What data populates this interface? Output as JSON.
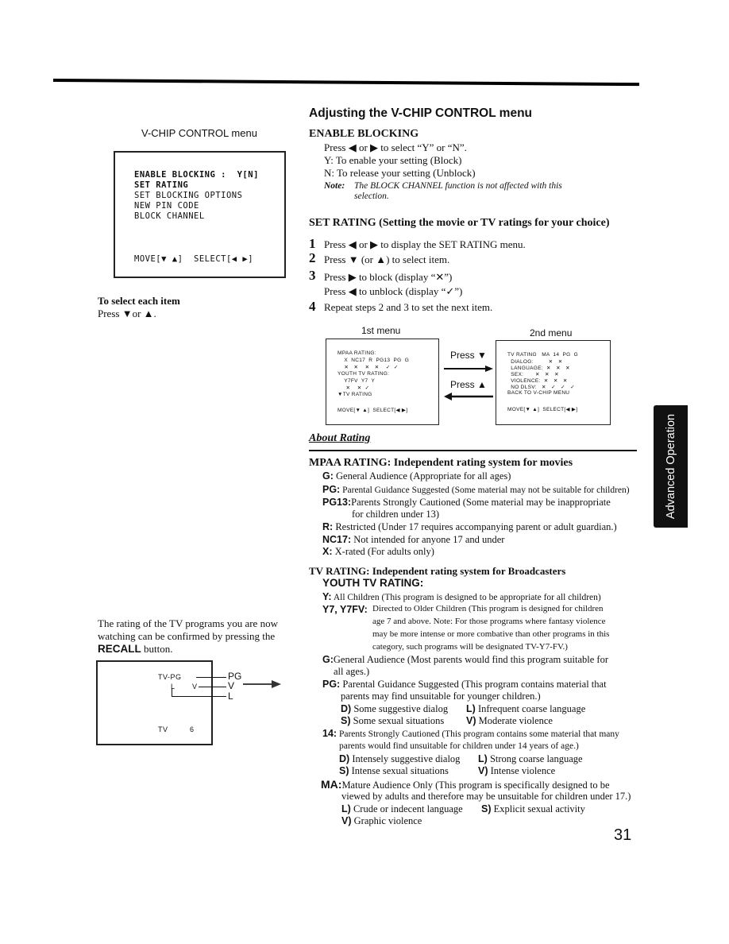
{
  "left": {
    "vchip_caption": "V-CHIP CONTROL menu",
    "vchip_menu": {
      "lines": [
        "ENABLE BLOCKING :  Y[N]",
        "SET RATING",
        "SET BLOCKING OPTIONS",
        "NEW PIN CODE",
        "BLOCK CHANNEL"
      ],
      "footer": "MOVE[▼ ▲]  SELECT[◀ ▶]"
    },
    "select_title": "To select each item",
    "select_body": "Press ▼or ▲.",
    "recall_text_pre": "The rating of the TV programs you are now watching can be confirmed by pressing the ",
    "recall_button": "RECALL",
    "recall_text_post": " button.",
    "tv_screen": {
      "rating_code": "TV-PG",
      "sub_l": "L",
      "sub_v": "V",
      "label_pg": "PG",
      "label_v": "V",
      "label_l": "L",
      "channel_label": "TV",
      "channel_number": "6"
    }
  },
  "right": {
    "title": "Adjusting the V-CHIP CONTROL menu",
    "enable_blocking": {
      "heading": "ENABLE BLOCKING",
      "lines": [
        "Press ◀ or ▶  to select “Y” or “N”.",
        "Y: To enable your setting (Block)",
        "N: To release your setting (Unblock)"
      ],
      "note_label": "Note:",
      "note_text": "The BLOCK CHANNEL function is not affected with this",
      "note_text2": "selection."
    },
    "set_rating": {
      "heading": "SET RATING (Setting the movie or TV ratings for your choice)",
      "steps": [
        {
          "num": "1",
          "text": "Press ◀ or ▶  to display the SET RATING menu."
        },
        {
          "num": "2",
          "text": "Press ▼  (or ▲) to select item."
        },
        {
          "num": "3",
          "text": "Press ▶ to block (display “✕”)",
          "text2": "Press ◀ to unblock (display “✓”)"
        },
        {
          "num": "4",
          "text": "Repeat steps 2 and 3 to set the next item."
        }
      ]
    },
    "menus": {
      "first_caption": "1st menu",
      "second_caption": "2nd menu",
      "press_down": "Press ▼",
      "press_up": "Press ▲",
      "first_lines": [
        "MPAA RATING:",
        "    X  NC17  R  PG13  PG  G",
        "    ✕   ✕    ✕   ✕    ✓  ✓",
        "YOUTH TV RATING:",
        "    Y7FV  Y7  Y",
        "     ✕    ✕  ✓",
        "▼TV RATING",
        "MOVE[▼ ▲]  SELECT[◀ ▶]"
      ],
      "second_lines": [
        "TV RATING   MA  14  PG  G",
        "  DIALOG:         ✕   ✕",
        "  LANGUAGE:  ✕   ✕   ✕",
        "  SEX:       ✕   ✕   ✕",
        "  VIOLENCE:  ✕   ✕   ✕",
        "  NO DLSV:   ✕   ✓   ✓   ✓",
        "BACK TO V-CHIP MENU",
        "MOVE[▼ ▲]  SELECT[◀ ▶]"
      ]
    },
    "about_rating": {
      "title": "About Rating",
      "mpaa_heading": "MPAA RATING: Independent rating system for movies",
      "mpaa": [
        {
          "key": "G:",
          "text": " General Audience (Appropriate for all ages)"
        },
        {
          "key": "PG:",
          "text": "  Parental Guidance Suggested (Some material may not be suitable for children)"
        },
        {
          "key": "PG13:",
          "text": "Parents Strongly Cautioned (Some material may be inappropriate",
          "text2": "for children under 13)"
        },
        {
          "key": "R:",
          "text": " Restricted (Under 17 requires accompanying parent or adult guardian.)"
        },
        {
          "key": "NC17:",
          "text": " Not intended for anyone 17 and under"
        },
        {
          "key": "X:",
          "text": "  X-rated (For adults only)"
        }
      ],
      "tv_heading": "TV RATING: Independent rating system for Broadcasters",
      "youth_heading": "YOUTH TV RATING:",
      "youth": [
        {
          "key": "Y:",
          "text": " All Children (This program is designed to be appropriate for all children)"
        },
        {
          "key": "Y7, Y7FV:",
          "lines": [
            "Directed to Older Children (This program is designed for children",
            "age 7 and above. Note: For those programs where fantasy violence",
            "may be more intense or more combative than other programs in this",
            "category, such programs will be designated TV-Y7-FV.)"
          ]
        }
      ],
      "tv": [
        {
          "key": "G:",
          "text": "General Audience (Most parents would find this program suitable for",
          "text2": "all ages.)"
        },
        {
          "key": "PG:",
          "text": " Parental Guidance Suggested (This program contains material that",
          "text2": "parents may find unsuitable for younger children.)",
          "subs": [
            [
              "D)",
              " Some suggestive dialog",
              "L)",
              " Infrequent coarse language"
            ],
            [
              "S)",
              " Some sexual situations",
              "V)",
              " Moderate violence"
            ]
          ]
        },
        {
          "key": "14:",
          "text": " Parents Strongly Cautioned (This program contains some material that many",
          "text2": "parents would find unsuitable for children under 14 years of age.)",
          "subs": [
            [
              "D)",
              " Intensely suggestive dialog",
              "L)",
              " Strong coarse language"
            ],
            [
              "S)",
              " Intense sexual situations",
              "V)",
              " Intense violence"
            ]
          ]
        },
        {
          "key": "MA:",
          "text": "Mature Audience Only (This program is specifically designed to be",
          "text2": "viewed by adults and therefore may be unsuitable for children under 17.)",
          "subs": [
            [
              "L)",
              " Crude or indecent language",
              "S)",
              " Explicit sexual activity"
            ],
            [
              "V)",
              " Graphic violence",
              "",
              ""
            ]
          ]
        }
      ]
    }
  },
  "side_tab": "Advanced Operation",
  "page_number": "31"
}
